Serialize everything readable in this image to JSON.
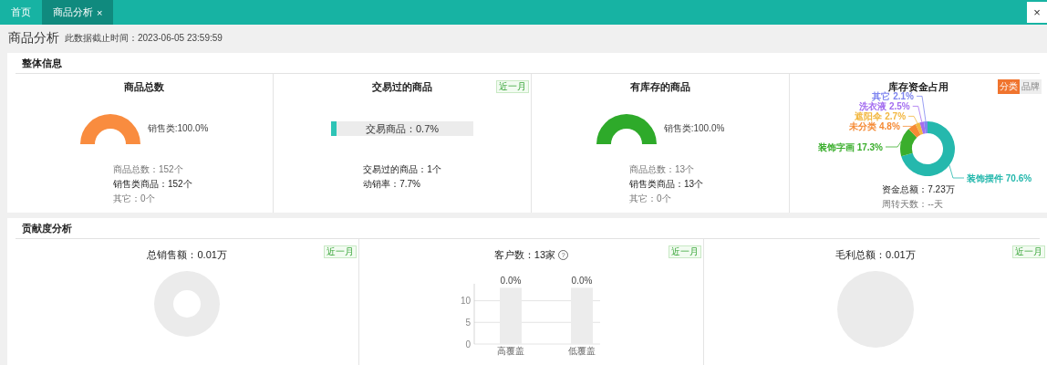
{
  "tabs": [
    {
      "label": "首页",
      "selected": false,
      "closable": false
    },
    {
      "label": "商品分析",
      "selected": true,
      "closable": true,
      "close": "×"
    }
  ],
  "window_close": "×",
  "page_title": "商品分析",
  "data_cutoff": "此数据截止时间：2023-06-05 23:59:59",
  "overview": {
    "title": "整体信息",
    "panels": [
      {
        "kind": "gauge",
        "title": "商品总数",
        "color": "#f98c3f",
        "legend": "销售类:100.0%",
        "stats": [
          {
            "text": "商品总数：152个",
            "emphasis": false
          },
          {
            "text": "销售类商品：152个",
            "emphasis": true
          },
          {
            "text": "其它：0个",
            "emphasis": false
          }
        ]
      },
      {
        "kind": "progress",
        "title": "交易过的商品",
        "badge": "近一月",
        "bar_label": "交易商品：0.7%",
        "level": 0.04,
        "stats": [
          {
            "text": "交易过的商品：1个",
            "emphasis": true
          },
          {
            "text": "动销率：7.7%",
            "emphasis": true
          }
        ]
      },
      {
        "kind": "gauge",
        "title": "有库存的商品",
        "color": "#2eaa2a",
        "legend": "销售类:100.0%",
        "stats": [
          {
            "text": "商品总数：13个",
            "emphasis": false
          },
          {
            "text": "销售类商品：13个",
            "emphasis": true
          },
          {
            "text": "其它：0个",
            "emphasis": false
          }
        ]
      },
      {
        "kind": "donut",
        "title": "库存资金占用",
        "toggles": [
          {
            "label": "分类",
            "selected": true
          },
          {
            "label": "品牌",
            "selected": false
          }
        ],
        "chart_data": {
          "type": "donut",
          "categories": [
            "装饰摆件",
            "装饰字画",
            "未分类",
            "遮阳伞",
            "洗衣液",
            "其它"
          ],
          "values": [
            70.6,
            17.3,
            4.8,
            2.7,
            2.5,
            2.1
          ],
          "colors": [
            "#25b8ad",
            "#3aae2c",
            "#f58a34",
            "#f2b740",
            "#a46ef0",
            "#7f86f0"
          ],
          "value_labels": [
            "70.6%",
            "17.3%",
            "4.8%",
            "2.7%",
            "2.5%",
            "2.1%"
          ]
        },
        "stats": [
          {
            "text": "资金总额：7.23万",
            "emphasis": true
          },
          {
            "text": "周转天数：--天",
            "emphasis": false
          }
        ]
      }
    ]
  },
  "contribution": {
    "title": "贡献度分析",
    "panels": [
      {
        "kind": "ring",
        "title": "总销售额：0.01万",
        "badge": "近一月"
      },
      {
        "kind": "bar",
        "title": "客户数：13家",
        "help": "?",
        "badge": "近一月",
        "chart_data": {
          "type": "bar",
          "categories": [
            "高覆盖",
            "低覆盖"
          ],
          "series": [
            {
              "color": "#ececec",
              "values": [
                13,
                13
              ]
            }
          ],
          "yticks": [
            0,
            5,
            10
          ],
          "ylim": [
            0,
            13.5
          ],
          "value_labels": [
            "0.0%",
            "0.0%"
          ]
        }
      },
      {
        "kind": "disc",
        "title": "毛利总额：0.01万",
        "badge": "近一月"
      }
    ]
  }
}
